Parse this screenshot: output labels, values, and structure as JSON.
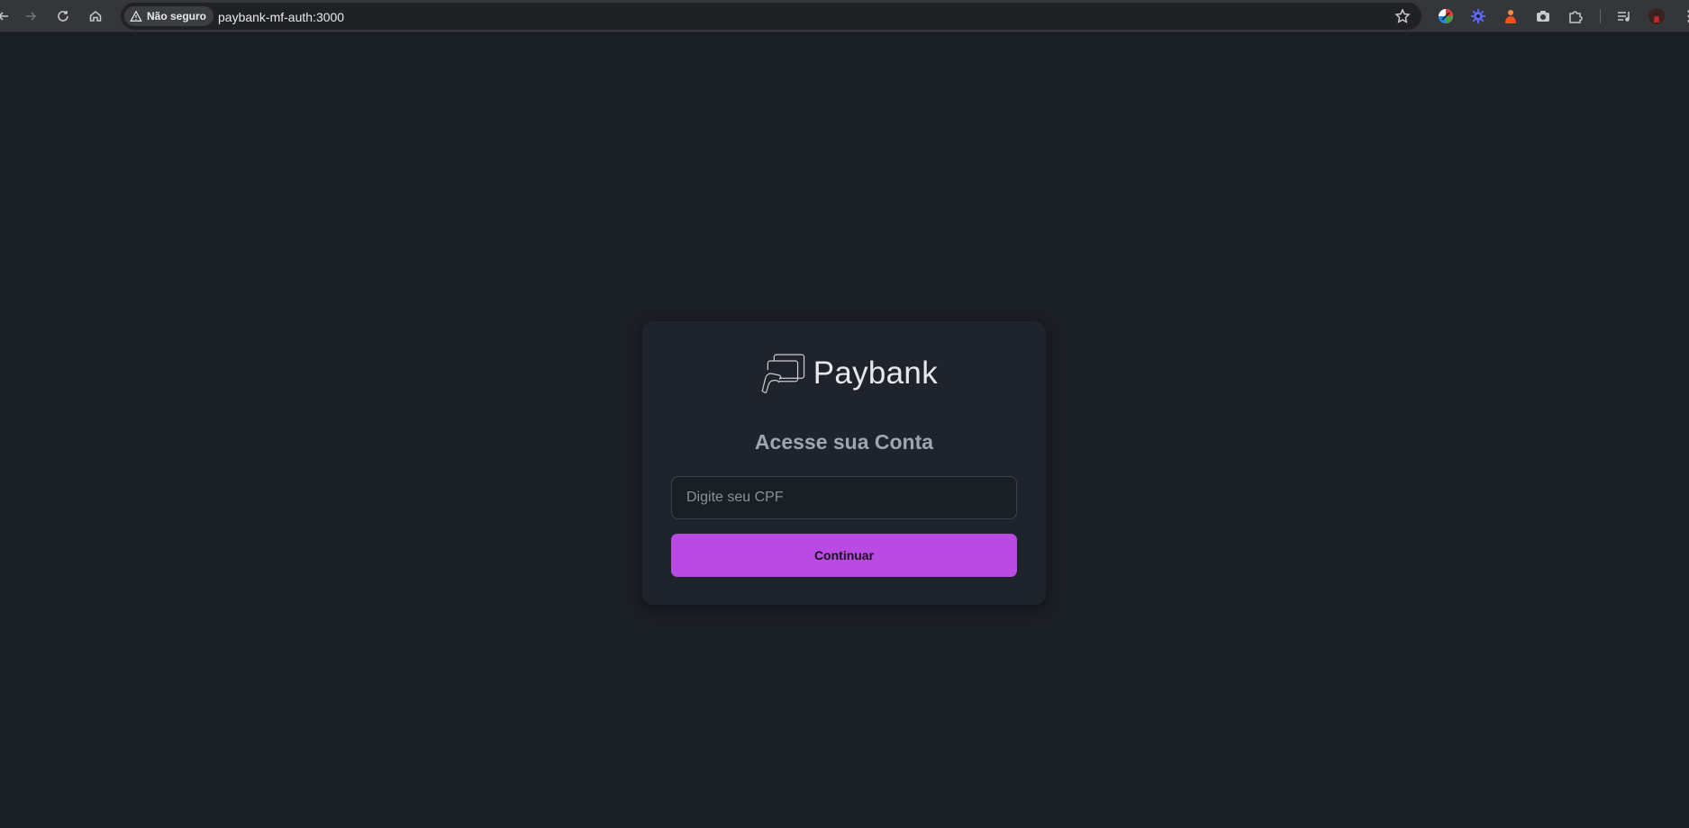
{
  "browser": {
    "security_label": "Não seguro",
    "url": "paybank-mf-auth:3000",
    "icons": {
      "back": "arrow-left-icon",
      "forward": "arrow-right-icon",
      "reload": "reload-icon",
      "home": "home-icon",
      "warning": "warning-triangle-icon",
      "bookmark": "star-icon",
      "extensions": [
        "color-wheel-icon",
        "blue-gear-icon",
        "orange-figure-icon",
        "camera-icon",
        "puzzle-icon",
        "media-queue-icon",
        "profile-avatar-icon",
        "more-menu-icon"
      ]
    }
  },
  "login": {
    "brand_name": "Paybank",
    "title": "Acesse sua Conta",
    "cpf_placeholder": "Digite seu CPF",
    "cpf_value": "",
    "continue_label": "Continuar"
  },
  "colors": {
    "page_background": "#1a1e25",
    "card_background": "#1f242c",
    "accent": "#b94be3",
    "title_text": "#9ea5b0"
  }
}
